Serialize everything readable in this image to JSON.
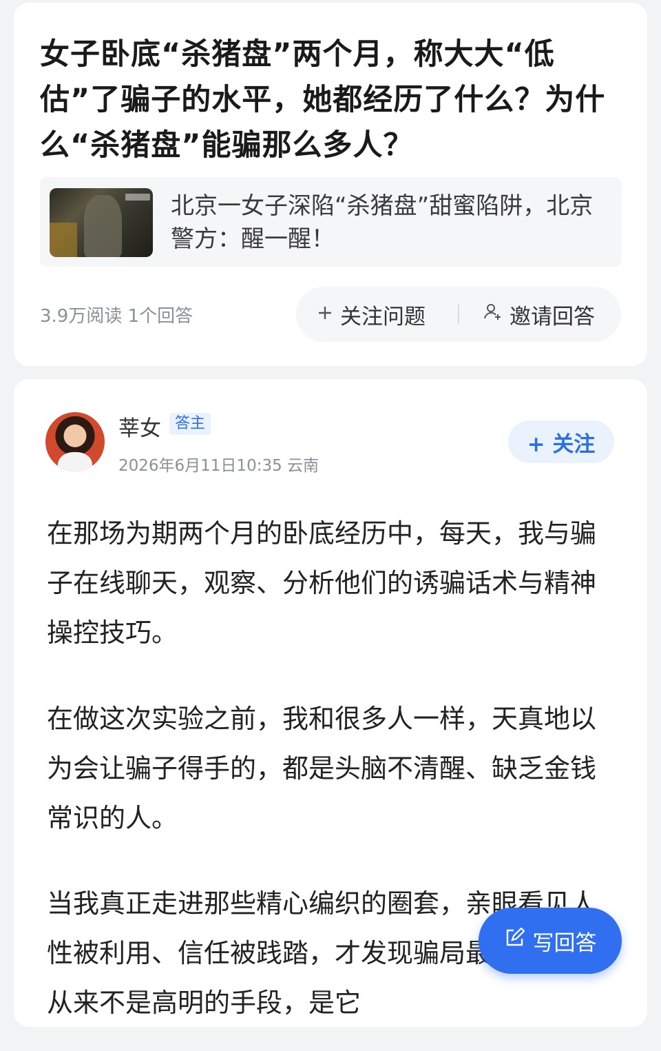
{
  "question": {
    "title": "女子卧底“杀猪盘”两个月，称大大“低估”了骗子的水平，她都经历了什么？为什么“杀猪盘”能骗那么多人？",
    "news_headline": "北京一女子深陷“杀猪盘”甜蜜陷阱，北京警方：醒一醒！",
    "stats": "3.9万阅读 1个回答",
    "follow_label": "关注问题",
    "invite_label": "邀请回答"
  },
  "answer": {
    "author": "莘女",
    "badge": "答主",
    "meta": "2026年6月11日10:35  云南",
    "follow_label": "+ 关注",
    "paragraphs": [
      "在那场为期两个月的卧底经历中，每天，我与骗子在线聊天，观察、分析他们的诱骗话术与精神操控技巧。",
      "在做这次实验之前，我和很多人一样，天真地以为会让骗子得手的，都是头脑不清醒、缺乏金钱常识的人。",
      "当我真正走进那些精心编织的圈套，亲眼看见人性被利用、信任被践踏，才发现骗局最可怕的，从来不是高明的手段，是它"
    ]
  },
  "fab": {
    "label": "写回答"
  },
  "icons": {
    "plus": "plus-icon",
    "invite": "person-plus-icon",
    "edit": "edit-icon"
  },
  "colors": {
    "accent": "#2f6ff0",
    "badge_bg": "#eaf2ff",
    "muted": "#8a8f99"
  }
}
